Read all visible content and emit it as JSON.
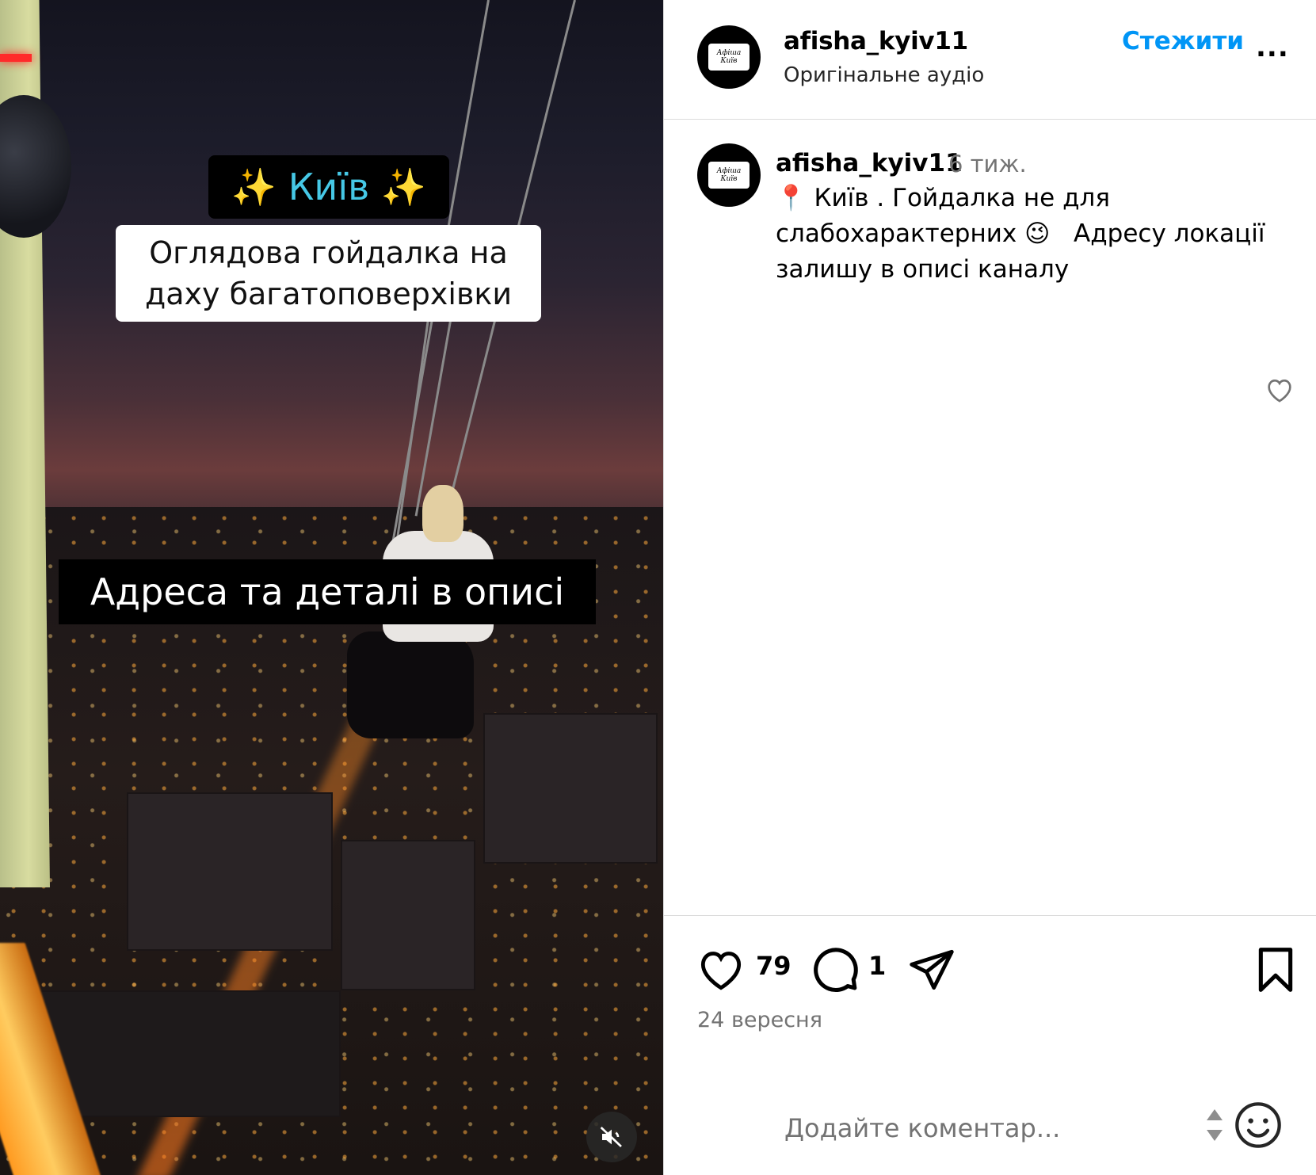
{
  "video": {
    "overlay_city": "Київ",
    "overlay_sparkle": "✨",
    "overlay_title_line1": "Оглядова гойдалка на",
    "overlay_title_line2": "даху багатоповерхівки",
    "overlay_address": "Адреса та деталі в описі"
  },
  "header": {
    "username": "afisha_kyiv11",
    "audio": "Оригінальне аудіо",
    "follow_label": "Стежити",
    "more_label": "..."
  },
  "avatar": {
    "logo_line1": "Афіша",
    "logo_line2": "Київ"
  },
  "caption": {
    "username": "afisha_kyiv11",
    "time": "6 тиж.",
    "pin_emoji": "📍",
    "text_part1": "Київ . Гойдалка не для слабохарактерних",
    "wink_emoji": "😉",
    "text_part2": "  Адресу локації залишу в описі каналу"
  },
  "actions": {
    "likes": "79",
    "comments": "1"
  },
  "post_date": "24 вересня",
  "comment_box": {
    "placeholder": "Додайте коментар..."
  },
  "icons": {
    "mute": "speaker-muted-icon",
    "heart": "heart-icon",
    "comment": "comment-icon",
    "share": "paper-plane-icon",
    "save": "bookmark-icon",
    "emoji": "smiley-icon"
  },
  "colors": {
    "follow": "#0095f6",
    "overlay_city": "#46c8e6",
    "secondary_text": "#737373",
    "divider": "#dbdbdb"
  }
}
